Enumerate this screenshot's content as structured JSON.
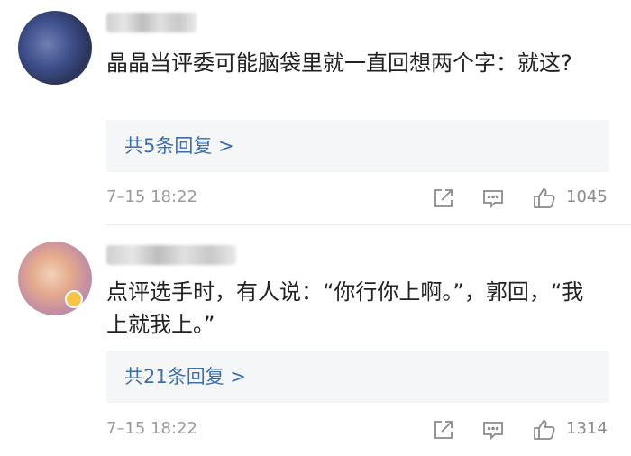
{
  "comments": [
    {
      "text": "晶晶当评委可能脑袋里就一直回想两个字：就这?",
      "replies_label": "共5条回复 >",
      "time": "7–15 18:22",
      "likes": "1045"
    },
    {
      "text": "点评选手时，有人说：“你行你上啊。”，郭回，“我上就我上。”",
      "replies_label": "共21条回复 >",
      "time": "7–15 18:22",
      "likes": "1314"
    }
  ],
  "icons": {
    "share": "share-icon",
    "reply": "comment-icon",
    "like": "thumbs-up-icon"
  }
}
